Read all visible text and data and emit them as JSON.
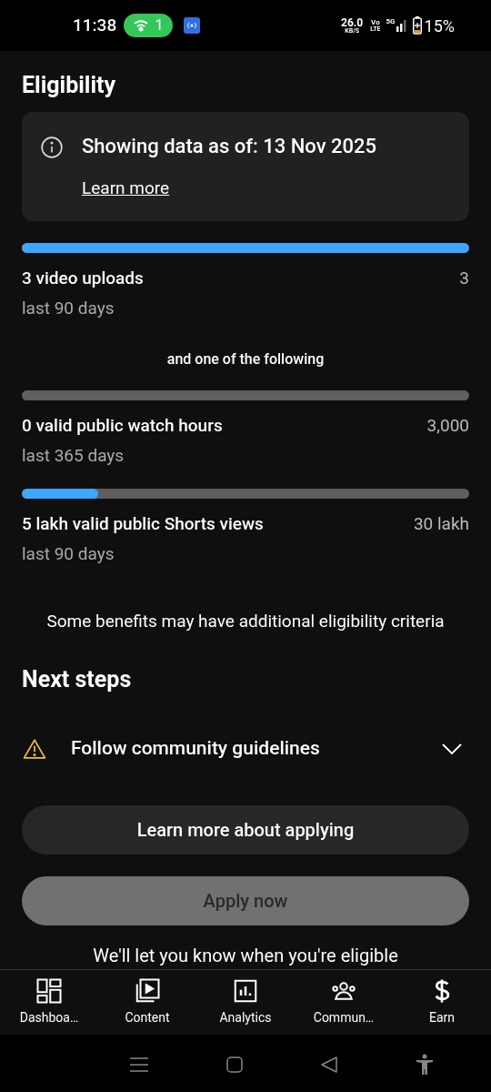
{
  "status_bar": {
    "time": "11:38",
    "hotspot_count": "1",
    "speed": "26.0",
    "speed_unit": "KB/S",
    "volte_top": "Vo",
    "volte_bottom": "LTE",
    "network": "5G",
    "battery": "15%"
  },
  "title": "Eligibility",
  "info_card": {
    "text": "Showing data as of: 13 Nov 2025",
    "link": "Learn more"
  },
  "requirements": [
    {
      "title": "3 video uploads",
      "subtitle": "last 90 days",
      "target": "3",
      "level": 1
    },
    {
      "kind": "separator",
      "text": "and one of the following"
    },
    {
      "title": "0 valid public watch hours",
      "subtitle": "last 365 days",
      "target": "3,000"
    },
    {
      "title": "5 lakh valid public Shorts views",
      "subtitle": "last 90 days",
      "target": "30 lakh",
      "level": 0.17
    }
  ],
  "note": "Some benefits may have additional eligibility criteria",
  "next_steps": {
    "title": "Next steps",
    "items": [
      {
        "label": "Follow community guidelines",
        "expanded": false
      }
    ]
  },
  "buttons": [
    {
      "label": "Learn more about applying",
      "disabled": false
    },
    {
      "label": "Apply now",
      "disabled": true
    }
  ],
  "footer_note": "We'll let you know when you're eligible",
  "bottom_nav": [
    {
      "label": "Dashboa…"
    },
    {
      "label": "Content"
    },
    {
      "label": "Analytics"
    },
    {
      "label": "Commun…"
    },
    {
      "label": "Earn"
    }
  ]
}
